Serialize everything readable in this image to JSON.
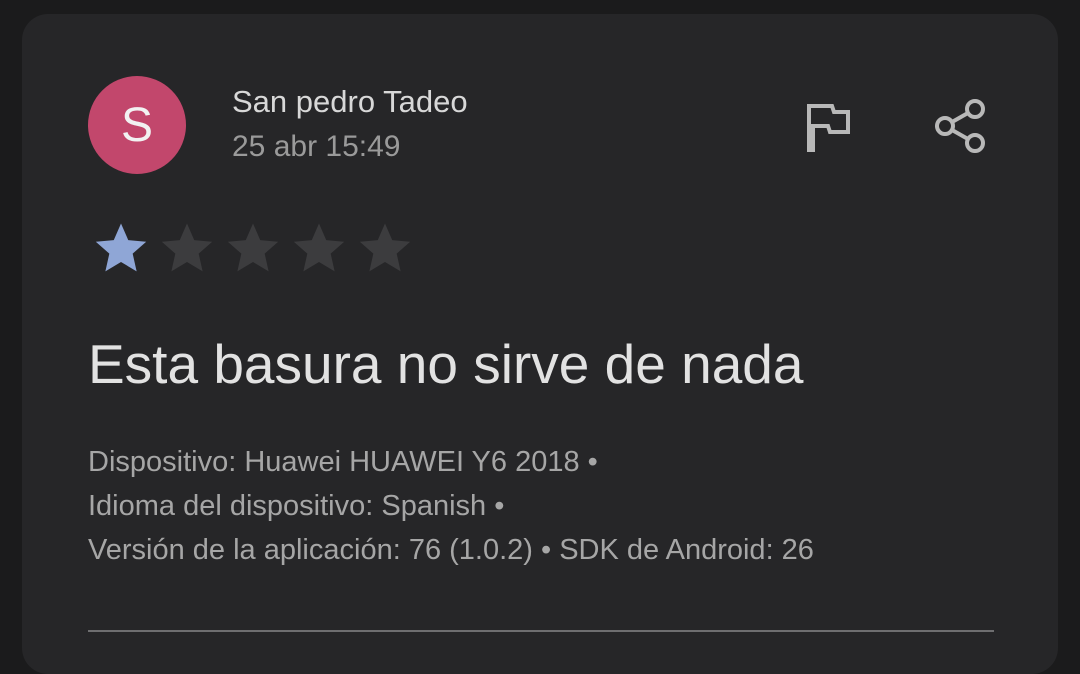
{
  "review": {
    "avatar_letter": "S",
    "avatar_color": "#c2476c",
    "author": "San pedro Tadeo",
    "date": "25 abr 15:49",
    "rating": 1,
    "max_rating": 5,
    "text": "Esta basura no sirve de nada",
    "device_line": "Dispositivo: Huawei HUAWEI Y6 2018 •",
    "language_line": "Idioma del dispositivo: Spanish •",
    "version_line": "Versión de la aplicación: 76 (1.0.2) • SDK de Android: 26"
  },
  "icons": {
    "flag": "flag-icon",
    "share": "share-icon",
    "star": "star-icon"
  },
  "colors": {
    "star_filled": "#8fa6d6",
    "star_empty": "#3c3c3e",
    "icon": "#b8b8b8"
  }
}
